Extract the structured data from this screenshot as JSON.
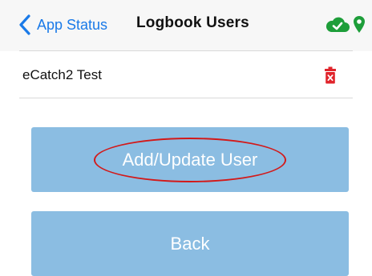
{
  "navbar": {
    "back_label": "App Status",
    "title": "Logbook Users",
    "status_icons": [
      "cloud-check-icon",
      "location-pin-icon"
    ]
  },
  "users": [
    {
      "name": "eCatch2 Test",
      "action_icon": "trash-icon"
    }
  ],
  "buttons": {
    "add_update_label": "Add/Update User",
    "back_label": "Back"
  },
  "colors": {
    "link_blue": "#1a7ae8",
    "button_blue": "#8bbde2",
    "status_green": "#1e9e3a",
    "trash_red": "#e0242b",
    "annotation_red": "#d31919"
  }
}
